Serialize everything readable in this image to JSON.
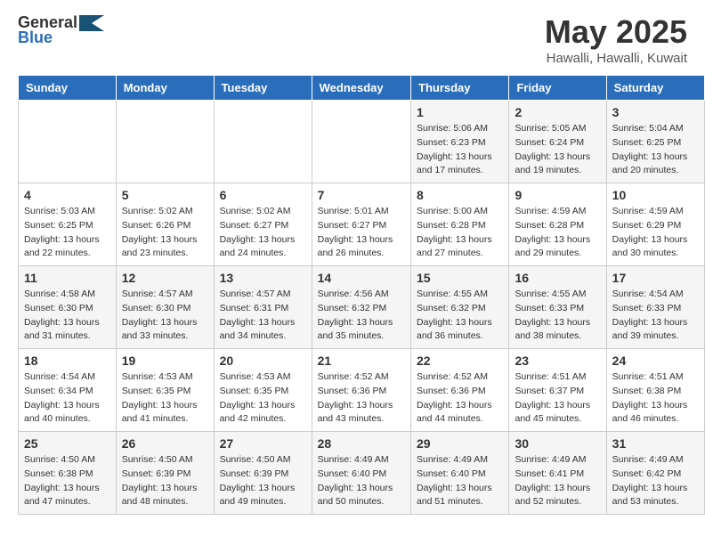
{
  "header": {
    "logo_general": "General",
    "logo_blue": "Blue",
    "main_title": "May 2025",
    "subtitle": "Hawalli, Hawalli, Kuwait"
  },
  "days_of_week": [
    "Sunday",
    "Monday",
    "Tuesday",
    "Wednesday",
    "Thursday",
    "Friday",
    "Saturday"
  ],
  "weeks": [
    [
      {
        "day": "",
        "info": ""
      },
      {
        "day": "",
        "info": ""
      },
      {
        "day": "",
        "info": ""
      },
      {
        "day": "",
        "info": ""
      },
      {
        "day": "1",
        "info": "Sunrise: 5:06 AM\nSunset: 6:23 PM\nDaylight: 13 hours\nand 17 minutes."
      },
      {
        "day": "2",
        "info": "Sunrise: 5:05 AM\nSunset: 6:24 PM\nDaylight: 13 hours\nand 19 minutes."
      },
      {
        "day": "3",
        "info": "Sunrise: 5:04 AM\nSunset: 6:25 PM\nDaylight: 13 hours\nand 20 minutes."
      }
    ],
    [
      {
        "day": "4",
        "info": "Sunrise: 5:03 AM\nSunset: 6:25 PM\nDaylight: 13 hours\nand 22 minutes."
      },
      {
        "day": "5",
        "info": "Sunrise: 5:02 AM\nSunset: 6:26 PM\nDaylight: 13 hours\nand 23 minutes."
      },
      {
        "day": "6",
        "info": "Sunrise: 5:02 AM\nSunset: 6:27 PM\nDaylight: 13 hours\nand 24 minutes."
      },
      {
        "day": "7",
        "info": "Sunrise: 5:01 AM\nSunset: 6:27 PM\nDaylight: 13 hours\nand 26 minutes."
      },
      {
        "day": "8",
        "info": "Sunrise: 5:00 AM\nSunset: 6:28 PM\nDaylight: 13 hours\nand 27 minutes."
      },
      {
        "day": "9",
        "info": "Sunrise: 4:59 AM\nSunset: 6:28 PM\nDaylight: 13 hours\nand 29 minutes."
      },
      {
        "day": "10",
        "info": "Sunrise: 4:59 AM\nSunset: 6:29 PM\nDaylight: 13 hours\nand 30 minutes."
      }
    ],
    [
      {
        "day": "11",
        "info": "Sunrise: 4:58 AM\nSunset: 6:30 PM\nDaylight: 13 hours\nand 31 minutes."
      },
      {
        "day": "12",
        "info": "Sunrise: 4:57 AM\nSunset: 6:30 PM\nDaylight: 13 hours\nand 33 minutes."
      },
      {
        "day": "13",
        "info": "Sunrise: 4:57 AM\nSunset: 6:31 PM\nDaylight: 13 hours\nand 34 minutes."
      },
      {
        "day": "14",
        "info": "Sunrise: 4:56 AM\nSunset: 6:32 PM\nDaylight: 13 hours\nand 35 minutes."
      },
      {
        "day": "15",
        "info": "Sunrise: 4:55 AM\nSunset: 6:32 PM\nDaylight: 13 hours\nand 36 minutes."
      },
      {
        "day": "16",
        "info": "Sunrise: 4:55 AM\nSunset: 6:33 PM\nDaylight: 13 hours\nand 38 minutes."
      },
      {
        "day": "17",
        "info": "Sunrise: 4:54 AM\nSunset: 6:33 PM\nDaylight: 13 hours\nand 39 minutes."
      }
    ],
    [
      {
        "day": "18",
        "info": "Sunrise: 4:54 AM\nSunset: 6:34 PM\nDaylight: 13 hours\nand 40 minutes."
      },
      {
        "day": "19",
        "info": "Sunrise: 4:53 AM\nSunset: 6:35 PM\nDaylight: 13 hours\nand 41 minutes."
      },
      {
        "day": "20",
        "info": "Sunrise: 4:53 AM\nSunset: 6:35 PM\nDaylight: 13 hours\nand 42 minutes."
      },
      {
        "day": "21",
        "info": "Sunrise: 4:52 AM\nSunset: 6:36 PM\nDaylight: 13 hours\nand 43 minutes."
      },
      {
        "day": "22",
        "info": "Sunrise: 4:52 AM\nSunset: 6:36 PM\nDaylight: 13 hours\nand 44 minutes."
      },
      {
        "day": "23",
        "info": "Sunrise: 4:51 AM\nSunset: 6:37 PM\nDaylight: 13 hours\nand 45 minutes."
      },
      {
        "day": "24",
        "info": "Sunrise: 4:51 AM\nSunset: 6:38 PM\nDaylight: 13 hours\nand 46 minutes."
      }
    ],
    [
      {
        "day": "25",
        "info": "Sunrise: 4:50 AM\nSunset: 6:38 PM\nDaylight: 13 hours\nand 47 minutes."
      },
      {
        "day": "26",
        "info": "Sunrise: 4:50 AM\nSunset: 6:39 PM\nDaylight: 13 hours\nand 48 minutes."
      },
      {
        "day": "27",
        "info": "Sunrise: 4:50 AM\nSunset: 6:39 PM\nDaylight: 13 hours\nand 49 minutes."
      },
      {
        "day": "28",
        "info": "Sunrise: 4:49 AM\nSunset: 6:40 PM\nDaylight: 13 hours\nand 50 minutes."
      },
      {
        "day": "29",
        "info": "Sunrise: 4:49 AM\nSunset: 6:40 PM\nDaylight: 13 hours\nand 51 minutes."
      },
      {
        "day": "30",
        "info": "Sunrise: 4:49 AM\nSunset: 6:41 PM\nDaylight: 13 hours\nand 52 minutes."
      },
      {
        "day": "31",
        "info": "Sunrise: 4:49 AM\nSunset: 6:42 PM\nDaylight: 13 hours\nand 53 minutes."
      }
    ]
  ]
}
